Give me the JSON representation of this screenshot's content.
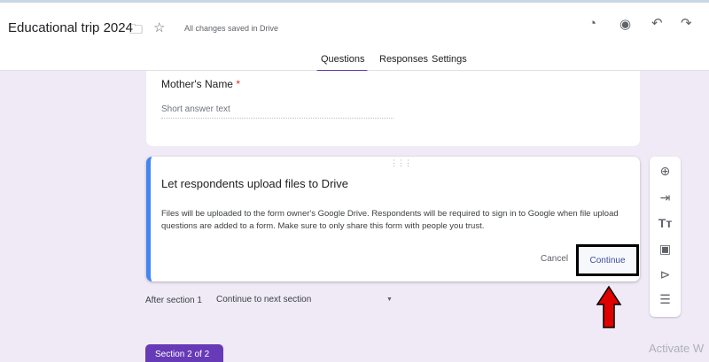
{
  "header": {
    "title": "Educational trip 2024",
    "save_status": "All changes saved in Drive"
  },
  "tabs": [
    {
      "label": "Questions",
      "active": true
    },
    {
      "label": "Responses"
    },
    {
      "label": "Settings"
    }
  ],
  "question": {
    "label": "Mother's Name",
    "required_mark": "*",
    "placeholder": "Short answer text"
  },
  "dialog": {
    "title": "Let respondents upload files to Drive",
    "body": "Files will be uploaded to the form owner's Google Drive. Respondents will be required to sign in to Google when file upload questions are added to a form. Make sure to only share this form with people you trust.",
    "cancel": "Cancel",
    "continue": "Continue"
  },
  "after_section": {
    "label": "After section 1",
    "value": "Continue to next section"
  },
  "section_badge": "Section 2 of 2",
  "watermark": "Activate W",
  "colors": {
    "accent": "#673ab7",
    "dialog_border": "#4285f4",
    "arrow": "#e00000"
  }
}
